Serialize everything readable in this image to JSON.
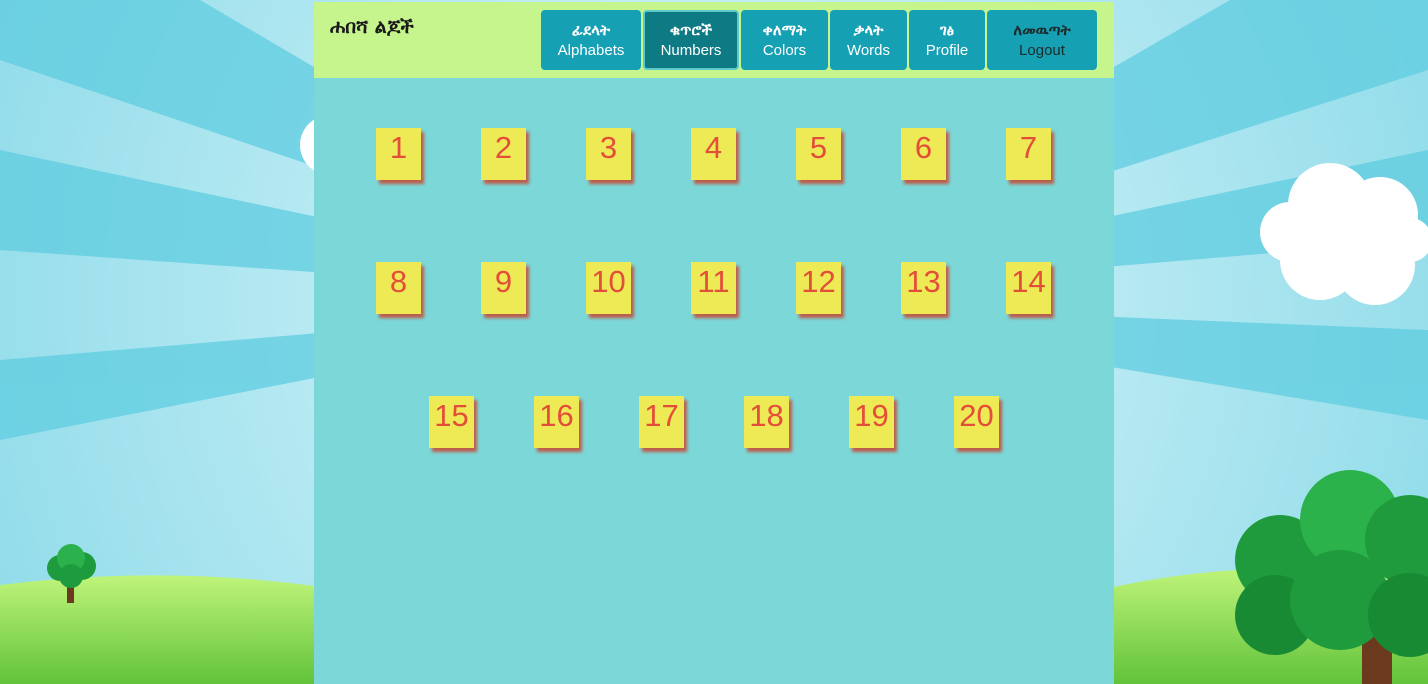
{
  "brand": {
    "title": "ሐበሻ ልጆች"
  },
  "nav": {
    "items": [
      {
        "amharic": "ፊደላት",
        "english": "Alphabets"
      },
      {
        "amharic": "ቁጥሮች",
        "english": "Numbers"
      },
      {
        "amharic": "ቀለማት",
        "english": "Colors"
      },
      {
        "amharic": "ቃላት",
        "english": "Words"
      },
      {
        "amharic": "ገፅ",
        "english": "Profile"
      },
      {
        "amharic": "ለመዉጣት",
        "english": "Logout"
      }
    ],
    "active_index": 1
  },
  "numbers": {
    "rows": [
      [
        "1",
        "2",
        "3",
        "4",
        "5",
        "6",
        "7"
      ],
      [
        "8",
        "9",
        "10",
        "11",
        "12",
        "13",
        "14"
      ],
      [
        "15",
        "16",
        "17",
        "18",
        "19",
        "20"
      ]
    ]
  },
  "colors": {
    "page_panel": "#7cd8d8",
    "navbar": "#c5f58c",
    "nav_button": "#16a0b4",
    "nav_button_active": "#0e7a84",
    "tile": "#eeea55",
    "tile_text": "#e34e3a"
  }
}
